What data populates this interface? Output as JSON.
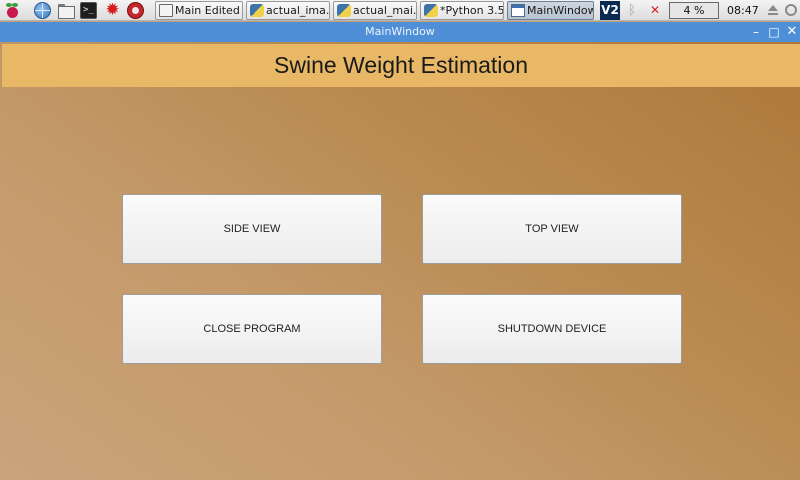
{
  "taskbar": {
    "launchers": [
      "raspberry-menu-icon",
      "web-browser-icon",
      "file-manager-icon",
      "terminal-icon",
      "math-burst-icon",
      "wolfram-icon"
    ],
    "terminal_glyph": ">_",
    "tasks": [
      {
        "label": "Main Edited",
        "icon": "folder-icon"
      },
      {
        "label": "actual_ima...",
        "icon": "python-icon"
      },
      {
        "label": "actual_mai...",
        "icon": "python-icon"
      },
      {
        "label": "*Python 3.5...",
        "icon": "python-icon"
      },
      {
        "label": "MainWindow",
        "icon": "window-icon"
      }
    ],
    "vnc_label": "V2",
    "cpu_usage": "4 %",
    "clock": "08:47"
  },
  "window": {
    "title": "MainWindow",
    "controls": {
      "minimize": "–",
      "maximize": "□",
      "close": "✕"
    },
    "titlebar_color": "#4f8fd8"
  },
  "app": {
    "title": "Swine Weight Estimation",
    "header_color": "#e8b866",
    "buttons": {
      "side_view": "SIDE VIEW",
      "top_view": "TOP VIEW",
      "close_program": "CLOSE PROGRAM",
      "shutdown_device": "SHUTDOWN DEVICE"
    }
  }
}
